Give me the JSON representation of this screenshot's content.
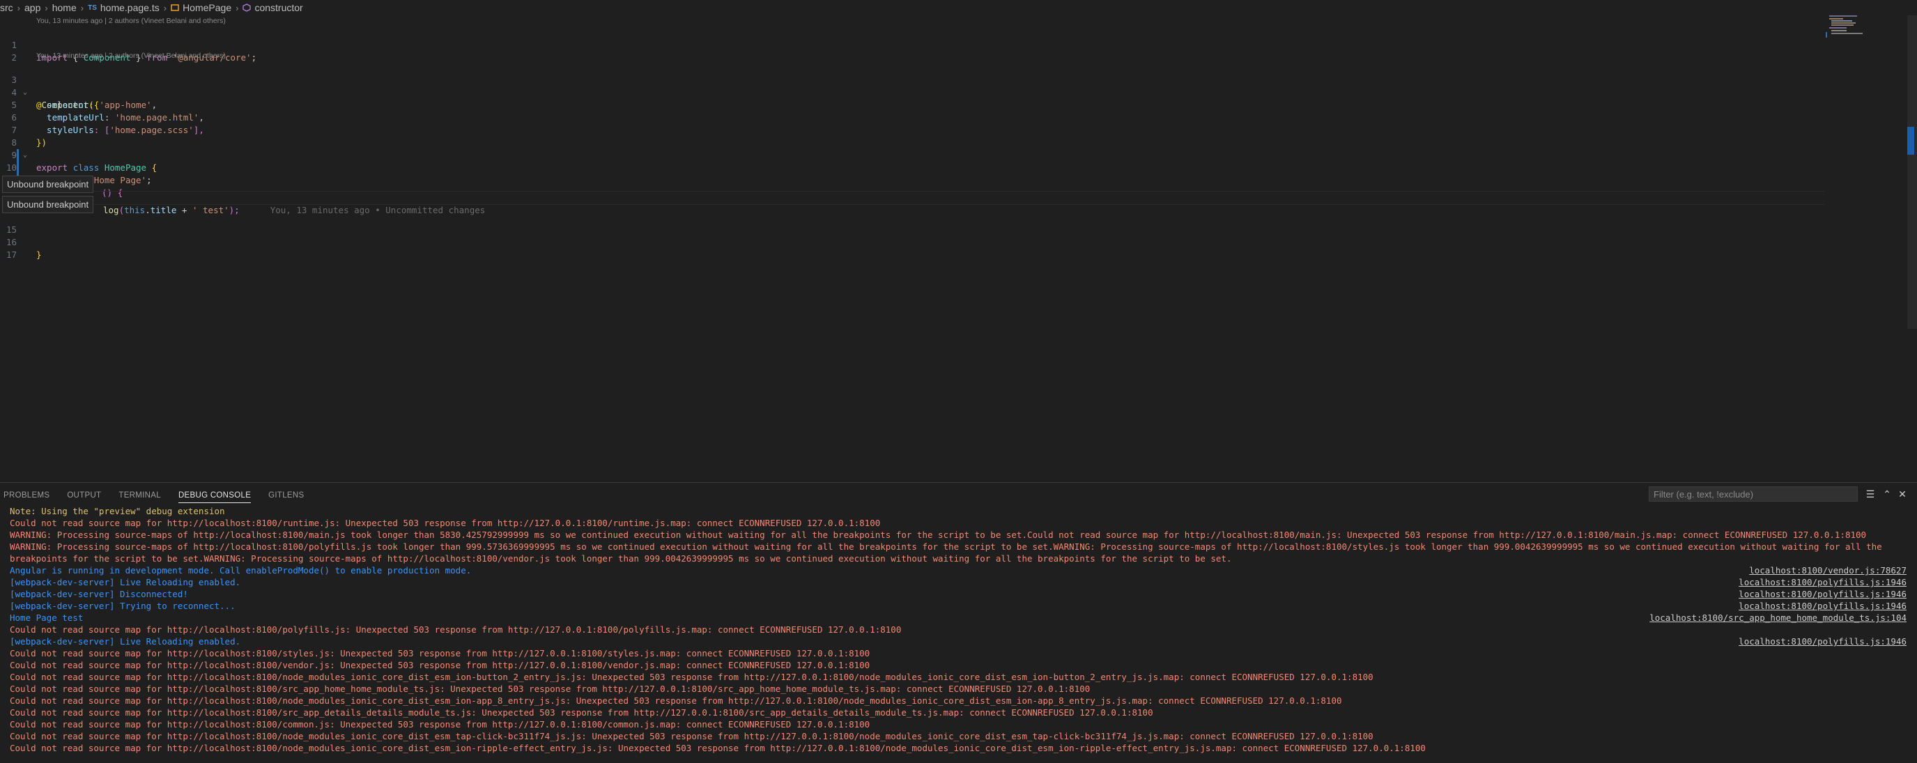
{
  "breadcrumb": {
    "items": [
      "src",
      "app",
      "home",
      "home.page.ts",
      "HomePage",
      "constructor"
    ],
    "ts_badge": "TS"
  },
  "editor": {
    "codelens": [
      "You, 13 minutes ago | 2 authors (Vineet Belani and others)",
      "You, 13 minutes ago | 2 authors (Vineet Belani and others)"
    ],
    "line_numbers": [
      "1",
      "2",
      "3",
      "4",
      "5",
      "6",
      "7",
      "8",
      "9",
      "10",
      "11",
      "15",
      "16",
      "17"
    ],
    "lines": {
      "l1": {
        "a": "import",
        "b": " { ",
        "c": "Component",
        "d": " } ",
        "e": "from",
        "f": " ",
        "g": "'@angular/core'",
        "h": ";"
      },
      "l3": {
        "a": "@",
        "b": "Component",
        "c": "({"
      },
      "l4": {
        "a": "  selector",
        "b": ": ",
        "c": "'app-home'",
        "d": ","
      },
      "l5": {
        "a": "  templateUrl",
        "b": ": ",
        "c": "'home.page.html'",
        "d": ","
      },
      "l6": {
        "a": "  styleUrls",
        "b": ": [",
        "c": "'home.page.scss'",
        "d": "],"
      },
      "l7": {
        "a": "})"
      },
      "l8": {
        "a": "export",
        "b": " ",
        "c": "class",
        "d": " ",
        "e": "HomePage",
        "f": " {"
      },
      "l10": {
        "a": "  title",
        "b": " = ",
        "c": "'Home Page'",
        "d": ";"
      },
      "l12": {
        "a": "() ",
        "b": "{"
      },
      "l13": {
        "a": "log",
        "b": "(",
        "c": "this",
        "d": ".",
        "e": "title",
        "f": " + ",
        "g": "' test'",
        "h": ");"
      },
      "l16": {
        "a": "}"
      }
    },
    "blame": "You, 13 minutes ago • Uncommitted changes",
    "tooltips": [
      "Unbound breakpoint",
      "Unbound breakpoint"
    ]
  },
  "panel": {
    "tabs": [
      "PROBLEMS",
      "OUTPUT",
      "TERMINAL",
      "DEBUG CONSOLE",
      "GITLENS"
    ],
    "filter_placeholder": "Filter (e.g. text, !exclude)",
    "icons": [
      "filter-list-icon",
      "chevron-up-icon",
      "close-icon"
    ],
    "console": [
      {
        "text": "Note: Using the \"preview\" debug extension",
        "color": "yellow"
      },
      {
        "text": "Could not read source map for http://localhost:8100/runtime.js: Unexpected 503 response from http://127.0.0.1:8100/runtime.js.map: connect ECONNREFUSED 127.0.0.1:8100",
        "color": "red"
      },
      {
        "text": "WARNING: Processing source-maps of http://localhost:8100/main.js took longer than 5830.425792999999 ms so we continued execution without waiting for all the breakpoints for the script to be set.Could not read source map for http://localhost:8100/main.js: Unexpected 503 response from http://127.0.0.1:8100/main.js.map: connect ECONNREFUSED 127.0.0.1:8100",
        "color": "red"
      },
      {
        "text": "WARNING: Processing source-maps of http://localhost:8100/polyfills.js took longer than 999.5736369999995 ms so we continued execution without waiting for all the breakpoints for the script to be set.WARNING: Processing source-maps of http://localhost:8100/styles.js took longer than 999.0042639999995 ms so we continued execution without waiting for all the breakpoints for the script to be set.WARNING: Processing source-maps of http://localhost:8100/vendor.js took longer than 999.0042639999995 ms so we continued execution without waiting for all the breakpoints for the script to be set.",
        "color": "red",
        "wrap": true
      },
      {
        "text": "Angular is running in development mode. Call enableProdMode() to enable production mode.",
        "color": "blue",
        "src": "localhost:8100/vendor.js:78627"
      },
      {
        "text": "[webpack-dev-server] Live Reloading enabled.",
        "color": "blue",
        "src": "localhost:8100/polyfills.js:1946"
      },
      {
        "text": "[webpack-dev-server] Disconnected!",
        "color": "blue",
        "src": "localhost:8100/polyfills.js:1946"
      },
      {
        "text": "[webpack-dev-server] Trying to reconnect...",
        "color": "blue",
        "src": "localhost:8100/polyfills.js:1946"
      },
      {
        "text": "Home Page test",
        "color": "blue",
        "src": "localhost:8100/src_app_home_home_module_ts.js:104"
      },
      {
        "text": "Could not read source map for http://localhost:8100/polyfills.js: Unexpected 503 response from http://127.0.0.1:8100/polyfills.js.map: connect ECONNREFUSED 127.0.0.1:8100",
        "color": "red"
      },
      {
        "text": "[webpack-dev-server] Live Reloading enabled.",
        "color": "blue",
        "src": "localhost:8100/polyfills.js:1946"
      },
      {
        "text": "Could not read source map for http://localhost:8100/styles.js: Unexpected 503 response from http://127.0.0.1:8100/styles.js.map: connect ECONNREFUSED 127.0.0.1:8100",
        "color": "red"
      },
      {
        "text": "Could not read source map for http://localhost:8100/vendor.js: Unexpected 503 response from http://127.0.0.1:8100/vendor.js.map: connect ECONNREFUSED 127.0.0.1:8100",
        "color": "red"
      },
      {
        "text": "Could not read source map for http://localhost:8100/node_modules_ionic_core_dist_esm_ion-button_2_entry_js.js: Unexpected 503 response from http://127.0.0.1:8100/node_modules_ionic_core_dist_esm_ion-button_2_entry_js.js.map: connect ECONNREFUSED 127.0.0.1:8100",
        "color": "red"
      },
      {
        "text": "Could not read source map for http://localhost:8100/src_app_home_home_module_ts.js: Unexpected 503 response from http://127.0.0.1:8100/src_app_home_home_module_ts.js.map: connect ECONNREFUSED 127.0.0.1:8100",
        "color": "red"
      },
      {
        "text": "Could not read source map for http://localhost:8100/node_modules_ionic_core_dist_esm_ion-app_8_entry_js.js: Unexpected 503 response from http://127.0.0.1:8100/node_modules_ionic_core_dist_esm_ion-app_8_entry_js.js.map: connect ECONNREFUSED 127.0.0.1:8100",
        "color": "red"
      },
      {
        "text": "Could not read source map for http://localhost:8100/src_app_details_details_module_ts.js: Unexpected 503 response from http://127.0.0.1:8100/src_app_details_details_module_ts.js.map: connect ECONNREFUSED 127.0.0.1:8100",
        "color": "red"
      },
      {
        "text": "Could not read source map for http://localhost:8100/common.js: Unexpected 503 response from http://127.0.0.1:8100/common.js.map: connect ECONNREFUSED 127.0.0.1:8100",
        "color": "red"
      },
      {
        "text": "Could not read source map for http://localhost:8100/node_modules_ionic_core_dist_esm_tap-click-bc311f74_js.js: Unexpected 503 response from http://127.0.0.1:8100/node_modules_ionic_core_dist_esm_tap-click-bc311f74_js.js.map: connect ECONNREFUSED 127.0.0.1:8100",
        "color": "red"
      },
      {
        "text": "Could not read source map for http://localhost:8100/node_modules_ionic_core_dist_esm_ion-ripple-effect_entry_js.js: Unexpected 503 response from http://127.0.0.1:8100/node_modules_ionic_core_dist_esm_ion-ripple-effect_entry_js.js.map: connect ECONNREFUSED 127.0.0.1:8100",
        "color": "red"
      }
    ]
  }
}
